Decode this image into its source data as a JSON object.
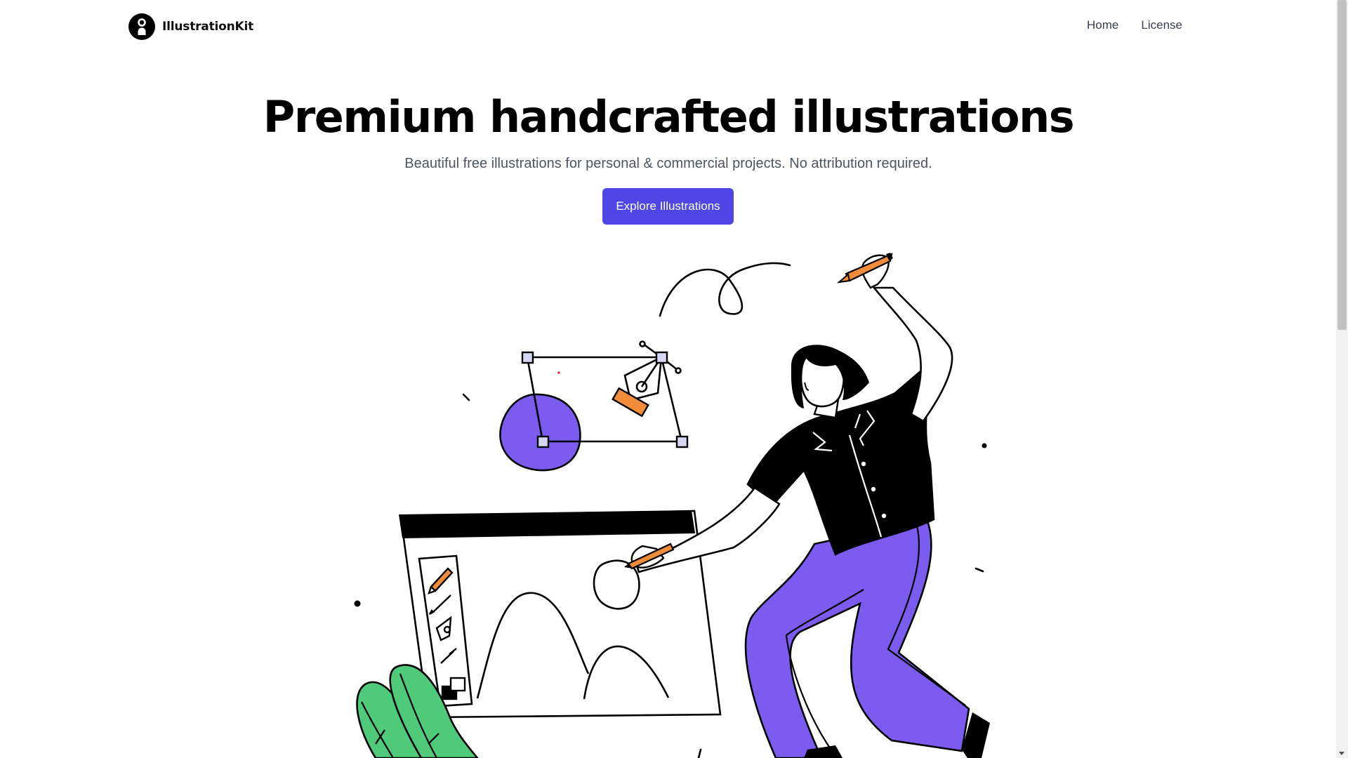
{
  "brand": {
    "name": "IllustrationKit"
  },
  "nav": {
    "items": [
      {
        "label": "Home"
      },
      {
        "label": "License"
      }
    ]
  },
  "hero": {
    "title": "Premium handcrafted illustrations",
    "subtitle": "Beautiful free illustrations for personal & commercial projects. No attribution required.",
    "cta_label": "Explore Illustrations"
  },
  "colors": {
    "accent": "#4f46e5",
    "purple": "#7c5cf0",
    "orange": "#f28c38",
    "green": "#4fc97a"
  },
  "illustration": {
    "icon": "woman-drawing-illustration"
  }
}
